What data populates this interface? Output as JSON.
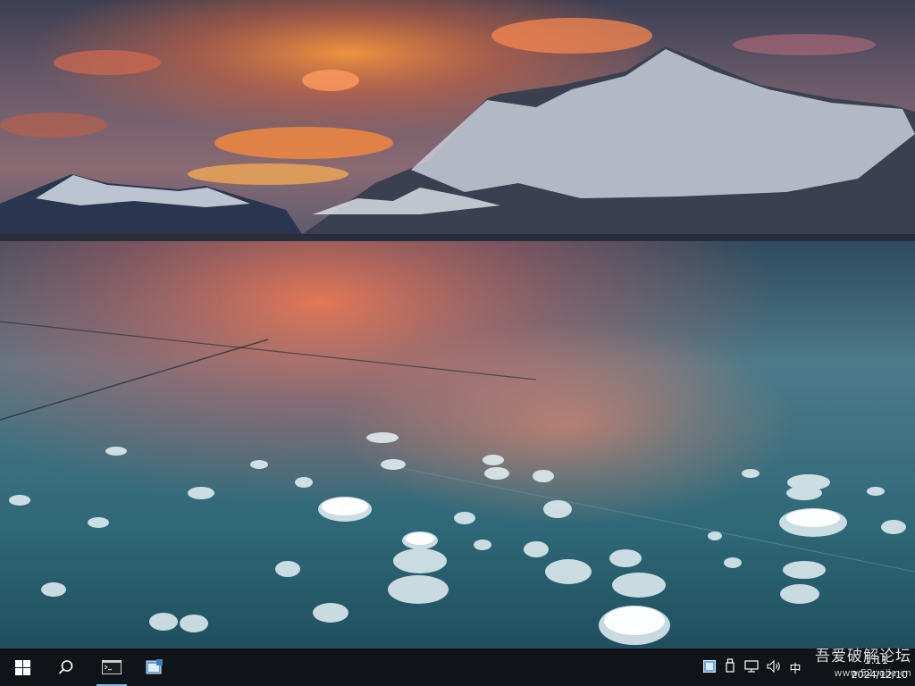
{
  "desktop": {
    "wallpaper_icon": "frozen-lake-mountain-sunset-wallpaper"
  },
  "taskbar": {
    "start_icon": "windows-logo-icon",
    "search_icon": "search-icon",
    "apps": [
      {
        "icon": "terminal-icon",
        "active": true
      },
      {
        "icon": "app-window-icon",
        "active": false
      }
    ],
    "tray": {
      "icons": [
        "notification-app-icon",
        "usb-device-icon",
        "network-icon",
        "volume-icon"
      ],
      "ime_label": "中"
    },
    "clock": {
      "time": "1:11",
      "date": "2024/12/10"
    }
  },
  "watermark": {
    "title": "吾爱破解论坛",
    "url": "www.52pojie.cn"
  },
  "colors": {
    "taskbar_bg": "#101418",
    "active_indicator": "#8ab4f8"
  }
}
